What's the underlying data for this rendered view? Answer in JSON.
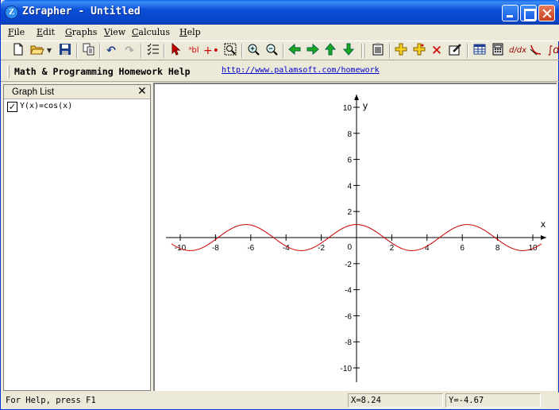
{
  "window": {
    "title": "ZGrapher - Untitled",
    "icon_letter": "Z"
  },
  "menu": [
    "File",
    "Edit",
    "Graphs",
    "View",
    "Calculus",
    "Help"
  ],
  "toolbar": {
    "buttons": [
      "new-icon",
      "open-icon",
      "dropdown-icon",
      "save-icon",
      "copy-icon",
      "undo-icon",
      "redo-icon",
      "graph-list-icon",
      "select-arrow-icon",
      "text-label-icon",
      "point-icon",
      "zoom-box-icon",
      "zoom-in-icon",
      "zoom-out-icon",
      "pan-left-icon",
      "pan-right-icon",
      "pan-up-icon",
      "pan-down-icon",
      "properties-icon",
      "add-graph-icon",
      "duplicate-graph-icon",
      "delete-graph-icon",
      "edit-graph-icon",
      "table-icon",
      "calculator-icon",
      "derivative-icon",
      "tangent-icon",
      "integral-icon"
    ]
  },
  "linkbar": {
    "title": "Math & Programming Homework Help",
    "url": "http://www.palamsoft.com/homework"
  },
  "graph_list": {
    "title": "Graph List",
    "close": "✕",
    "items": [
      {
        "label": "Y(x)=cos(x)",
        "checked": true,
        "check_mark": "✓"
      }
    ]
  },
  "chart_data": {
    "type": "line",
    "series": [
      {
        "name": "Y(x)=cos(x)",
        "function": "cos",
        "color": "#cc0000"
      }
    ],
    "xlabel": "x",
    "ylabel": "y",
    "xlim": [
      -10.5,
      10.5
    ],
    "ylim": [
      -11,
      11
    ],
    "x_ticks": [
      -10,
      -8,
      -6,
      -4,
      -2,
      2,
      4,
      6,
      8,
      10
    ],
    "y_ticks": [
      10,
      8,
      6,
      4,
      2,
      -2,
      -4,
      -6,
      -8,
      -10
    ],
    "origin_label": "0",
    "grid": false
  },
  "status": {
    "help": "For Help, press F1",
    "x": "X=8.24",
    "y": "Y=-4.67"
  }
}
